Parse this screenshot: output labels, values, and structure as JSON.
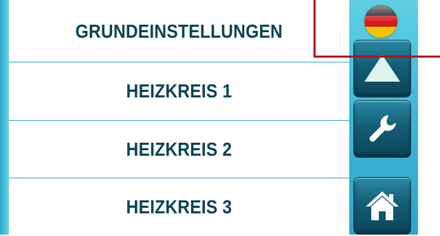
{
  "menu": {
    "items": [
      {
        "label": "GRUNDEINSTELLUNGEN"
      },
      {
        "label": "HEIZKREIS 1"
      },
      {
        "label": "HEIZKREIS 2"
      },
      {
        "label": "HEIZKREIS 3"
      }
    ]
  },
  "sidebar": {
    "language_flag": "germany-flag-icon",
    "buttons": [
      {
        "icon": "arrow-up-icon"
      },
      {
        "icon": "wrench-icon"
      },
      {
        "icon": "home-icon"
      }
    ]
  },
  "colors": {
    "text": "#0a4457",
    "accent": "#2aa7c6",
    "button_dark": "#135e75",
    "highlight": "#b3121a"
  }
}
